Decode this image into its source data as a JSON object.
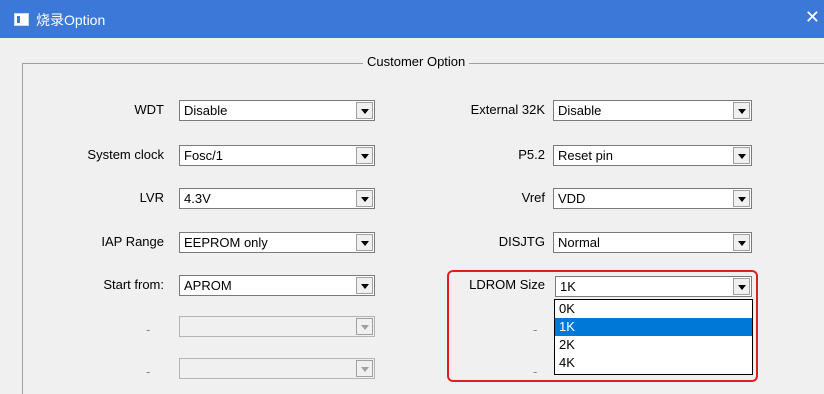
{
  "window": {
    "title": "烧录Option",
    "close_glyph": "✕"
  },
  "group": {
    "legend": "Customer Option"
  },
  "left": [
    {
      "label": "WDT",
      "value": "Disable"
    },
    {
      "label": "System clock",
      "value": "Fosc/1"
    },
    {
      "label": "LVR",
      "value": "4.3V"
    },
    {
      "label": "IAP Range",
      "value": "EEPROM only"
    },
    {
      "label": "Start from:",
      "value": "APROM"
    },
    {
      "label": "-",
      "value": ""
    },
    {
      "label": "-",
      "value": ""
    }
  ],
  "right": [
    {
      "label": "External 32K",
      "value": "Disable"
    },
    {
      "label": "P5.2",
      "value": "Reset pin"
    },
    {
      "label": "Vref",
      "value": "VDD"
    },
    {
      "label": "DISJTG",
      "value": "Normal"
    },
    {
      "label": "LDROM Size",
      "value": "1K"
    },
    {
      "label": "-",
      "value": ""
    },
    {
      "label": "-",
      "value": ""
    }
  ],
  "ldrom_dropdown": {
    "options": [
      "0K",
      "1K",
      "2K",
      "4K"
    ],
    "selected": "1K"
  },
  "colors": {
    "titlebar": "#3c78d8",
    "selection": "#0078d7",
    "highlight": "#e02020"
  }
}
